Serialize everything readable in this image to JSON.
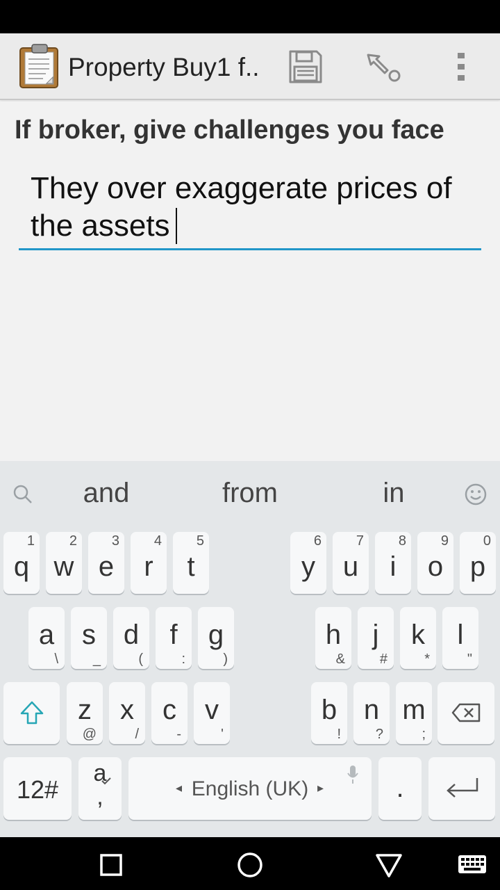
{
  "app": {
    "title": "Property Buy1 f..",
    "icons": {
      "app": "clipboard-icon",
      "save": "save-icon",
      "jump": "go-to-icon",
      "menu": "overflow-menu-icon"
    }
  },
  "form": {
    "question": "If broker, give challenges you face",
    "answer": "They over exaggerate prices of the assets"
  },
  "keyboard": {
    "suggestions": [
      "and",
      "from",
      "in"
    ],
    "row1": [
      {
        "k": "q",
        "h": "1"
      },
      {
        "k": "w",
        "h": "2"
      },
      {
        "k": "e",
        "h": "3"
      },
      {
        "k": "r",
        "h": "4"
      },
      {
        "k": "t",
        "h": "5"
      },
      {
        "k": "y",
        "h": "6"
      },
      {
        "k": "u",
        "h": "7"
      },
      {
        "k": "i",
        "h": "8"
      },
      {
        "k": "o",
        "h": "9"
      },
      {
        "k": "p",
        "h": "0"
      }
    ],
    "row2": [
      {
        "k": "a",
        "h": "\\"
      },
      {
        "k": "s",
        "h": "_"
      },
      {
        "k": "d",
        "h": "("
      },
      {
        "k": "f",
        "h": ":"
      },
      {
        "k": "g",
        "h": ")"
      },
      {
        "k": "h",
        "h": "&"
      },
      {
        "k": "j",
        "h": "#"
      },
      {
        "k": "k",
        "h": "*"
      },
      {
        "k": "l",
        "h": "\""
      }
    ],
    "row3": [
      {
        "k": "z",
        "h": "@"
      },
      {
        "k": "x",
        "h": "/"
      },
      {
        "k": "c",
        "h": "-"
      },
      {
        "k": "v",
        "h": "'"
      },
      {
        "k": "b",
        "h": "!"
      },
      {
        "k": "n",
        "h": "?"
      },
      {
        "k": "m",
        "h": ";"
      }
    ],
    "symbols_label": "12#",
    "lang_key_top": "a",
    "lang_key_bottom": ",",
    "space_label": "English (UK)",
    "period_label": "."
  },
  "colors": {
    "accent": "#2196c8",
    "shift": "#26a6b5"
  }
}
